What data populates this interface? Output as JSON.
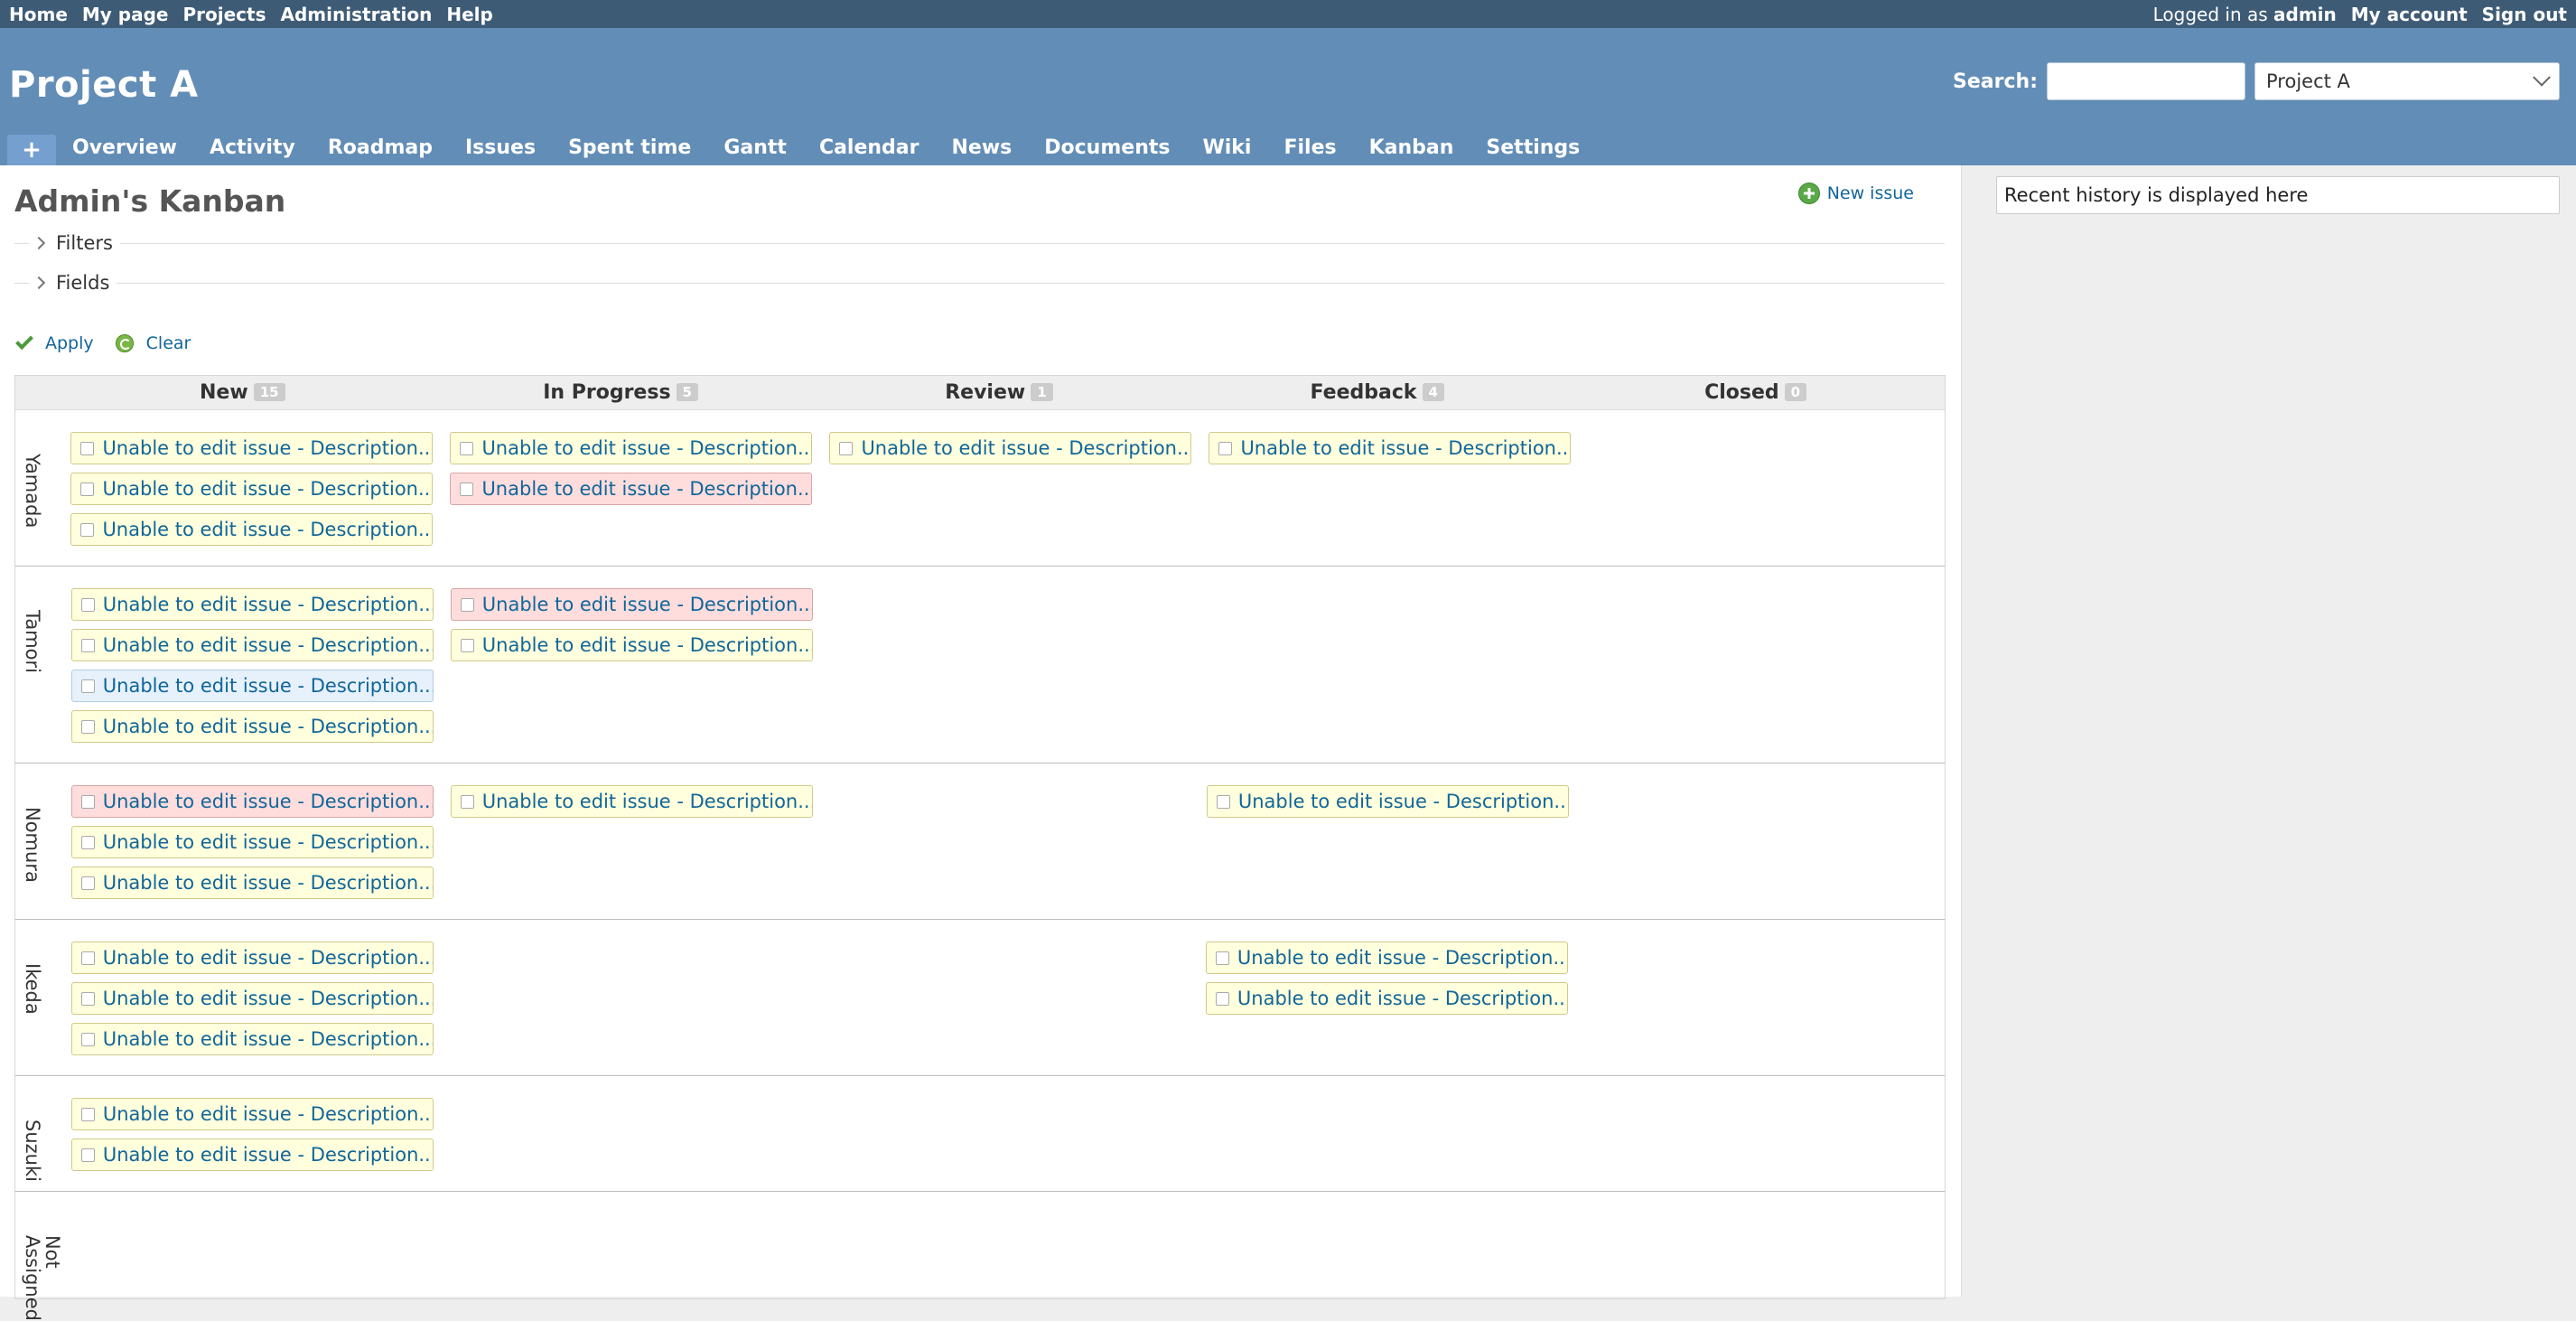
{
  "top_menu": {
    "left": [
      "Home",
      "My page",
      "Projects",
      "Administration",
      "Help"
    ],
    "logged_prefix": "Logged in as",
    "user": "admin",
    "my_account": "My account",
    "sign_out": "Sign out"
  },
  "header": {
    "project_title": "Project A",
    "search_label": "Search:",
    "search_value": "",
    "project_jump": "Project A"
  },
  "main_menu": {
    "plus": "+",
    "tabs": [
      "Overview",
      "Activity",
      "Roadmap",
      "Issues",
      "Spent time",
      "Gantt",
      "Calendar",
      "News",
      "Documents",
      "Wiki",
      "Files",
      "Kanban",
      "Settings"
    ]
  },
  "page": {
    "title": "Admin's Kanban",
    "new_issue": "New issue",
    "filters": "Filters",
    "fields": "Fields",
    "apply": "Apply",
    "clear": "Clear"
  },
  "sidebar": {
    "history": "Recent history is displayed here"
  },
  "board": {
    "card_text": "Unable to edit issue - Description...",
    "columns": [
      {
        "name": "New",
        "count": "15"
      },
      {
        "name": "In Progress",
        "count": "5"
      },
      {
        "name": "Review",
        "count": "1"
      },
      {
        "name": "Feedback",
        "count": "4"
      },
      {
        "name": "Closed",
        "count": "0"
      }
    ],
    "lanes": [
      {
        "name": "Yamada",
        "cells": [
          [
            "yellow",
            "yellow",
            "yellow"
          ],
          [
            "yellow",
            "red"
          ],
          [
            "yellow"
          ],
          [
            "yellow"
          ],
          []
        ]
      },
      {
        "name": "Tamori",
        "cells": [
          [
            "yellow",
            "yellow",
            "blue",
            "yellow"
          ],
          [
            "red",
            "yellow"
          ],
          [],
          [],
          []
        ]
      },
      {
        "name": "Nomura",
        "cells": [
          [
            "red",
            "yellow",
            "yellow"
          ],
          [
            "yellow"
          ],
          [],
          [
            "yellow"
          ],
          []
        ]
      },
      {
        "name": "Ikeda",
        "cells": [
          [
            "yellow",
            "yellow",
            "yellow"
          ],
          [],
          [],
          [
            "yellow",
            "yellow"
          ],
          []
        ]
      },
      {
        "name": "Suzuki",
        "cells": [
          [
            "yellow",
            "yellow"
          ],
          [],
          [],
          [],
          []
        ]
      },
      {
        "name": "Not\nAssigned",
        "cells": [
          [],
          [],
          [],
          [],
          []
        ]
      }
    ]
  }
}
